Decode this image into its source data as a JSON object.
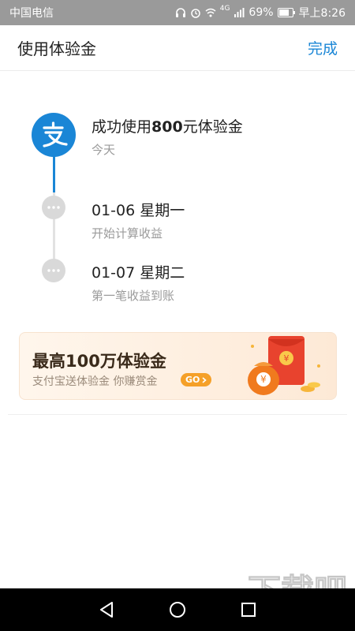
{
  "status_bar": {
    "carrier": "中国电信",
    "battery_percent": "69%",
    "time": "早上8:26",
    "network": "4G"
  },
  "header": {
    "title": "使用体验金",
    "done_label": "完成"
  },
  "timeline": {
    "steps": [
      {
        "title_prefix": "成功使用",
        "amount": "800",
        "title_suffix": "元体验金",
        "subtitle": "今天"
      },
      {
        "title": "01-06 星期一",
        "subtitle": "开始计算收益"
      },
      {
        "title": "01-07 星期二",
        "subtitle": "第一笔收益到账"
      }
    ]
  },
  "promo": {
    "title": "最高100万体验金",
    "subtitle": "支付宝送体验金  你赚赏金",
    "button_label": "GO",
    "coin_symbol": "¥"
  },
  "icons": {
    "logo": "alipay-logo-icon",
    "nav_back": "triangle-back-icon",
    "nav_home": "circle-home-icon",
    "nav_recent": "square-recent-icon"
  },
  "watermark": {
    "text": "下载吧"
  },
  "colors": {
    "accent": "#1a86d6",
    "status_bar": "#9a9a9a",
    "promo_accent": "#f5a028"
  }
}
